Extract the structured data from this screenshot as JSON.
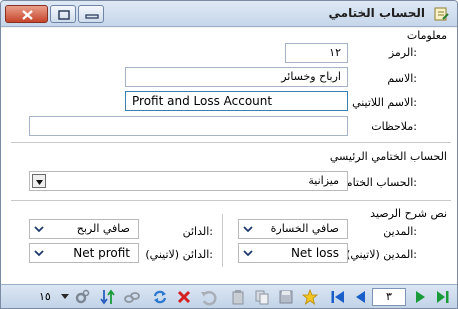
{
  "window": {
    "title": "الحساب الختامي"
  },
  "info_group": {
    "title": "معلومات",
    "code_label": "الرمز:",
    "code_value": "١٢",
    "name_label": "الاسم:",
    "name_value": "ارباح وخسائر",
    "latin_name_label": "الاسم اللاتيني:",
    "latin_name_value": "Profit and Loss Account",
    "notes_label": "ملاحظات:",
    "notes_value": ""
  },
  "main_group": {
    "title": "الحساب الختامي الرئيسي",
    "account_label": "الحساب الختامي:",
    "account_value": "ميزانية"
  },
  "balance_group": {
    "title": "نص شرح الرصيد",
    "debit_label": "المدين:",
    "debit_value": "صافي الخسارة",
    "credit_label": "الدائن:",
    "credit_value": "صافي الربح",
    "debit_latin_label": "المدين (لاتيني):",
    "debit_latin_value": "Net loss",
    "credit_latin_label": "الدائن (لاتيني):",
    "credit_latin_value": "Net profit"
  },
  "toolbar": {
    "page_number": "٣",
    "page_size": "١٥",
    "icons": [
      "next-last-icon",
      "next-icon",
      "prev-icon",
      "first-icon",
      "favorite-icon",
      "save-icon",
      "copy-icon",
      "paste-icon",
      "undo-icon",
      "delete-icon",
      "refresh-icon",
      "link-icon",
      "sort-icon",
      "settings-icon"
    ]
  }
}
